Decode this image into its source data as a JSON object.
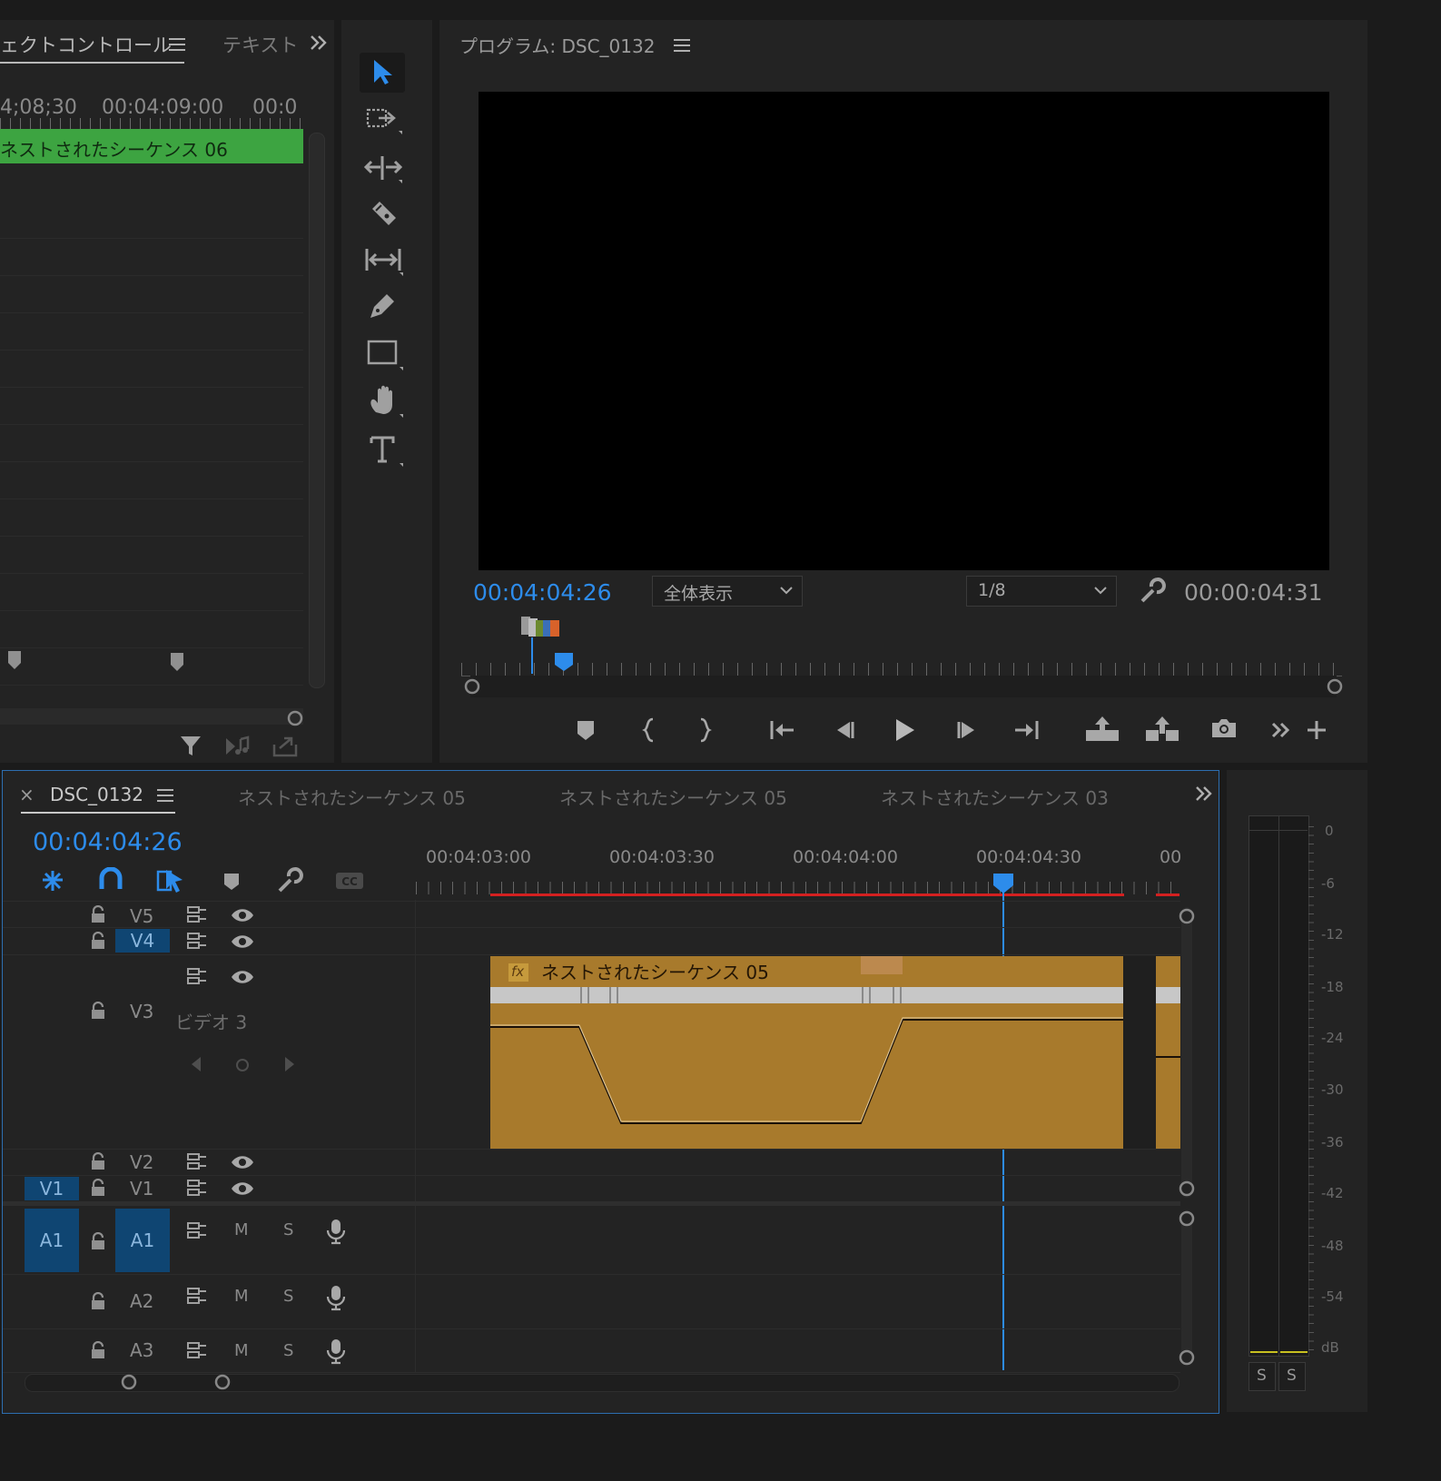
{
  "effect_controls": {
    "tab_label": "ェクトコントロール",
    "tab2_label": "テキスト",
    "timecodes": [
      "4;08;30",
      "00:04:09:00",
      "00:0"
    ],
    "clip_label": "ネストされたシーケンス 06"
  },
  "program": {
    "title": "プログラム: DSC_0132",
    "timecode_left": "00:04:04:26",
    "fit_select": "全体表示",
    "resolution_select": "1/8",
    "timecode_right": "00:00:04:31"
  },
  "timeline": {
    "tabs": [
      {
        "label": "DSC_0132"
      },
      {
        "label": "ネストされたシーケンス 05"
      },
      {
        "label": "ネストされたシーケンス 05"
      },
      {
        "label": "ネストされたシーケンス 03"
      }
    ],
    "close_glyph": "×",
    "timecode": "00:04:04:26",
    "ruler": [
      "00:04:03:00",
      "00:04:03:30",
      "00:04:04:00",
      "00:04:04:30",
      "00"
    ],
    "video_tracks": [
      {
        "id": "V5"
      },
      {
        "id": "V4"
      },
      {
        "id": "V3",
        "name": "ビデオ 3"
      },
      {
        "id": "V2"
      },
      {
        "id": "V1",
        "source": "V1"
      }
    ],
    "audio_tracks": [
      {
        "id": "A1",
        "source": "A1",
        "m": "M",
        "s": "S"
      },
      {
        "id": "A2",
        "m": "M",
        "s": "S"
      },
      {
        "id": "A3",
        "m": "M",
        "s": "S"
      }
    ],
    "clip": {
      "fx": "fx",
      "label": "ネストされたシーケンス 05",
      "color": "#a87a2c"
    }
  },
  "meter": {
    "scale": [
      "0",
      "-6",
      "-12",
      "-18",
      "-24",
      "-30",
      "-36",
      "-42",
      "-48",
      "-54",
      "dB"
    ],
    "solo_buttons": [
      "S",
      "S"
    ]
  },
  "colors": {
    "accent": "#2d8ceb",
    "clip": "#a87a2c",
    "work_bar": "#d32020",
    "green_clip": "#3da441"
  }
}
